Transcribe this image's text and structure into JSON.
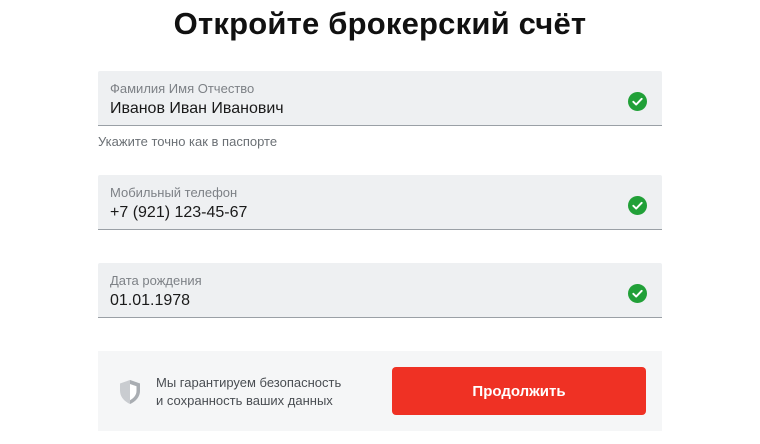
{
  "title": "Откройте брокерский счёт",
  "fields": [
    {
      "label": "Фамилия Имя Отчество",
      "value": "Иванов Иван Иванович",
      "valid": true
    },
    {
      "label": "Мобильный телефон",
      "value": "+7 (921) 123-45-67",
      "valid": true
    },
    {
      "label": "Дата рождения",
      "value": "01.01.1978",
      "valid": true
    }
  ],
  "hint": "Укажите точно как в паспорте",
  "footer": {
    "guarantee_line1": "Мы гарантируем безопасность",
    "guarantee_line2": "и сохранность ваших данных",
    "continue_label": "Продолжить"
  },
  "colors": {
    "accent": "#ef3124",
    "valid": "#21a038",
    "field_bg": "#eef0f2"
  },
  "icons": {
    "valid": "check-circle-icon",
    "security": "shield-icon"
  }
}
